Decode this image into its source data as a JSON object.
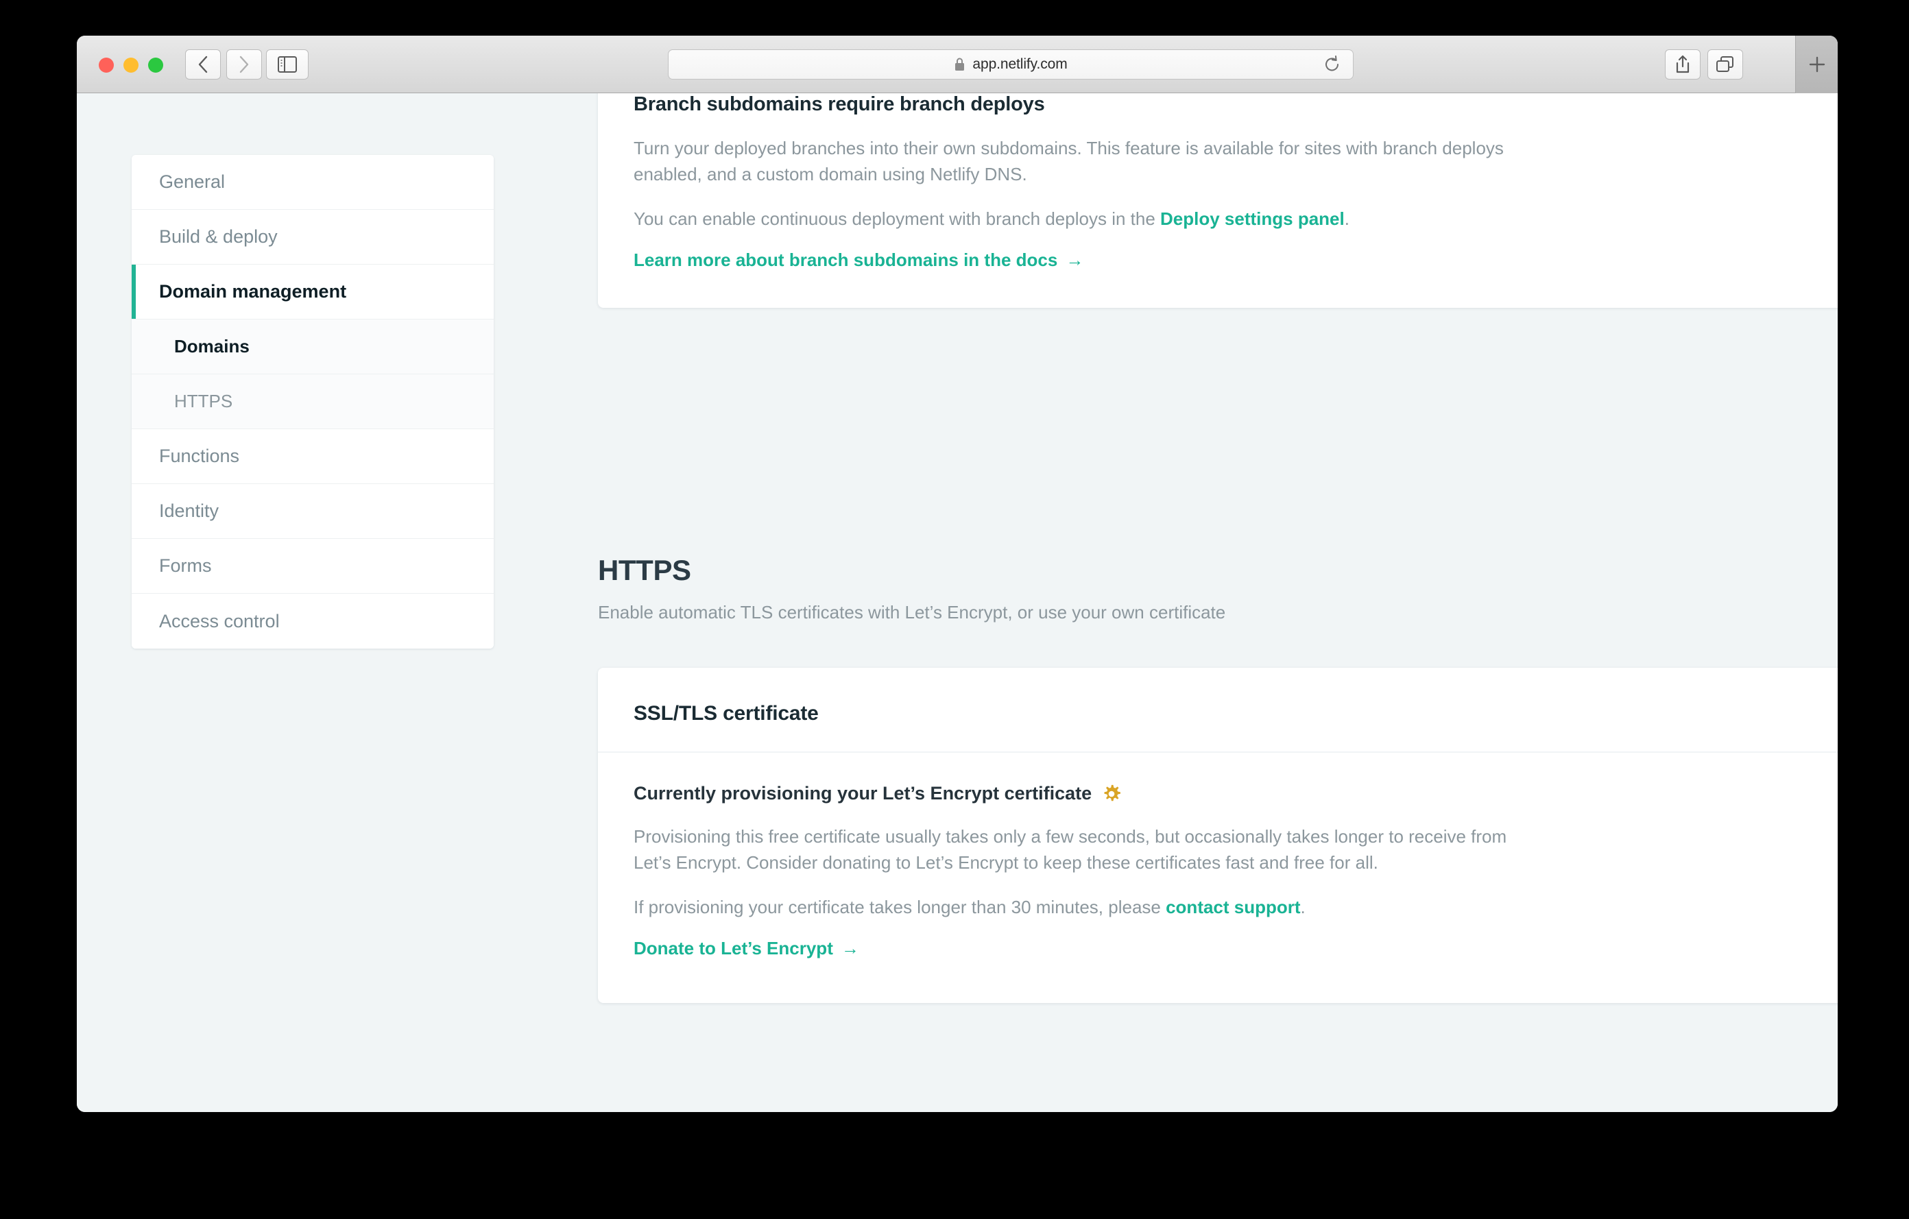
{
  "browser": {
    "url": "app.netlify.com",
    "icons": {
      "back": "back-chevron-icon",
      "forward": "forward-chevron-icon",
      "sidebar": "sidebar-toggle-icon",
      "lock": "lock-icon",
      "reload": "reload-icon",
      "share": "share-icon",
      "tabs": "tab-overview-icon",
      "newtab": "new-tab-plus-icon"
    }
  },
  "sidebar": {
    "items": [
      {
        "label": "General",
        "active": false,
        "sub": false
      },
      {
        "label": "Build & deploy",
        "active": false,
        "sub": false
      },
      {
        "label": "Domain management",
        "active": true,
        "sub": false
      },
      {
        "label": "Domains",
        "active": false,
        "sub": true,
        "current": true
      },
      {
        "label": "HTTPS",
        "active": false,
        "sub": true,
        "current": false
      },
      {
        "label": "Functions",
        "active": false,
        "sub": false
      },
      {
        "label": "Identity",
        "active": false,
        "sub": false
      },
      {
        "label": "Forms",
        "active": false,
        "sub": false
      },
      {
        "label": "Access control",
        "active": false,
        "sub": false
      }
    ]
  },
  "branch_card": {
    "title": "Branch subdomains require branch deploys",
    "paragraph1": "Turn your deployed branches into their own subdomains. This feature is available for sites with branch deploys enabled, and a custom domain using Netlify DNS.",
    "paragraph2_prefix": "You can enable continuous deployment with branch deploys in the ",
    "paragraph2_link": "Deploy settings panel",
    "paragraph2_suffix": ".",
    "docs_link": "Learn more about branch subdomains in the docs",
    "docs_link_arrow": "→"
  },
  "https_section": {
    "title": "HTTPS",
    "subtitle": "Enable automatic TLS certificates with Let’s Encrypt, or use your own certificate"
  },
  "ssl_card": {
    "heading": "SSL/TLS certificate",
    "status": "Currently provisioning your Let’s Encrypt certificate",
    "status_icon": "gear-icon",
    "status_icon_color": "#d9a425",
    "paragraph1": "Provisioning this free certificate usually takes only a few seconds, but occasionally takes longer to receive from Let’s Encrypt. Consider donating to Let’s Encrypt to keep these certificates fast and free for all.",
    "paragraph2_prefix": "If provisioning your certificate takes longer than 30 minutes, please ",
    "paragraph2_link": "contact support",
    "paragraph2_suffix": ".",
    "donate_link": "Donate to Let’s Encrypt",
    "donate_link_arrow": "→"
  },
  "colors": {
    "accent_teal": "#19b394",
    "page_bg": "#f1f5f6",
    "card_bg": "#ffffff",
    "text_muted": "#8c979d",
    "text_dark": "#1a2b33",
    "gear_gold": "#d9a425"
  }
}
